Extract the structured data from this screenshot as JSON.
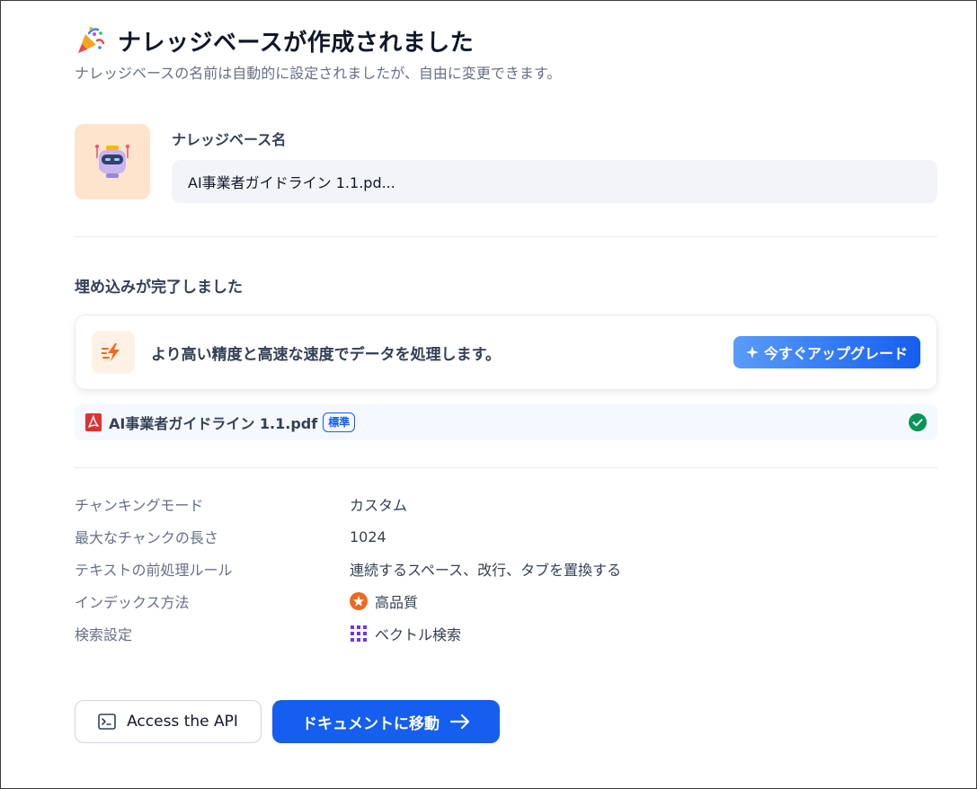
{
  "header": {
    "title": "ナレッジベースが作成されました",
    "subtitle": "ナレッジベースの名前は自動的に設定されましたが、自由に変更できます。",
    "title_icon": "party-popper-icon"
  },
  "knowledge_base": {
    "label": "ナレッジベース名",
    "name_value": "AI事業者ガイドライン 1.1.pd...",
    "icon": "robot-icon"
  },
  "embedding": {
    "title": "埋め込みが完了しました",
    "upgrade": {
      "text": "より高い精度と高速な速度でデータを処理します。",
      "button_label": "今すぐアップグレード",
      "icon": "bolt-icon"
    },
    "file": {
      "name": "AI事業者ガイドライン 1.1.pdf",
      "badge": "標準",
      "icon": "pdf-icon",
      "status_icon": "check-circle-icon"
    }
  },
  "properties": [
    {
      "key": "チャンキングモード",
      "value": "カスタム"
    },
    {
      "key": "最大なチャンクの長さ",
      "value": "1024"
    },
    {
      "key": "テキストの前処理ルール",
      "value": "連続するスペース、改行、タブを置換する"
    },
    {
      "key": "インデックス方法",
      "value": "高品質",
      "icon": "high-quality-icon"
    },
    {
      "key": "検索設定",
      "value": "ベクトル検索",
      "icon": "vector-grid-icon"
    }
  ],
  "actions": {
    "api_label": "Access the API",
    "go_label": "ドキュメントに移動"
  },
  "colors": {
    "primary": "#155eef",
    "accent_orange": "#f79009",
    "success": "#079455"
  }
}
